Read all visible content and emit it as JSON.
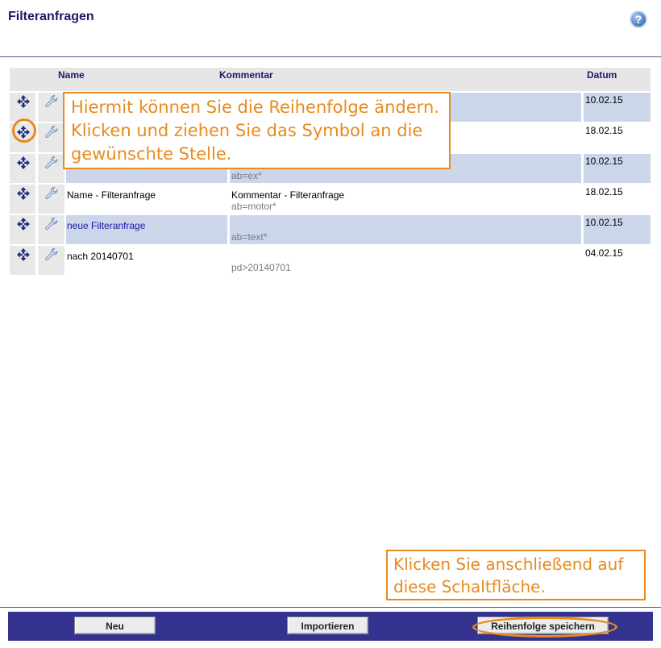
{
  "header": {
    "title": "Filteranfragen",
    "help_icon": "question-mark-icon",
    "help_label": "?"
  },
  "table": {
    "columns": {
      "name": "Name",
      "comment": "Kommentar",
      "date": "Datum"
    },
    "rows": [
      {
        "name": "",
        "comment": "",
        "filter": "",
        "date": "10.02.15",
        "link": false
      },
      {
        "name": "",
        "comment": "",
        "filter": "",
        "date": "18.02.15",
        "link": false
      },
      {
        "name": "",
        "comment": "",
        "filter": "ab=ex*",
        "date": "10.02.15",
        "link": false
      },
      {
        "name": "Name - Filteranfrage",
        "comment": "Kommentar - Filteranfrage",
        "filter": "ab=motor*",
        "date": "18.02.15",
        "link": false
      },
      {
        "name": "neue Filteranfrage",
        "comment": "",
        "filter": "ab=text*",
        "date": "10.02.15",
        "link": true
      },
      {
        "name": "nach 20140701",
        "comment": "",
        "filter": "pd>20140701",
        "date": "04.02.15",
        "link": false
      }
    ]
  },
  "callouts": {
    "reorder": {
      "line1": "Hiermit können Sie die Reihenfolge ändern.",
      "line2": "Klicken und ziehen Sie das Symbol an die",
      "line3": "gewünschte Stelle."
    },
    "save": {
      "line1": "Klicken Sie anschließend auf",
      "line2": "diese Schaltfläche."
    }
  },
  "footer": {
    "new_label": "Neu",
    "import_label": "Importieren",
    "save_order_label": "Reihenfolge speichern"
  },
  "colors": {
    "accent": "#e88a1e",
    "footer_bar": "#33338f",
    "alt_row": "#cbd6eb",
    "heading": "#1a1a66"
  },
  "icons": {
    "move": "move-arrows-icon",
    "edit": "wrench-icon"
  }
}
